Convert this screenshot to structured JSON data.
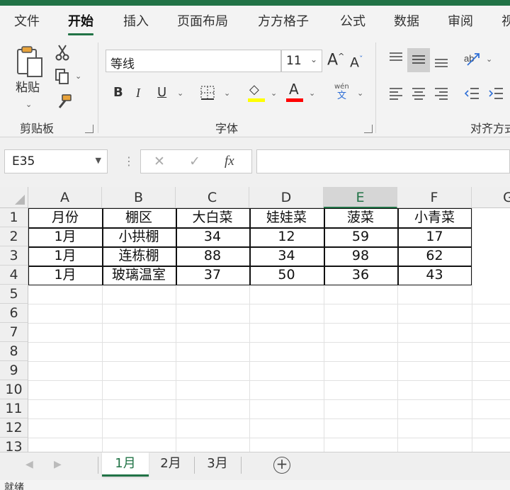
{
  "ribbon_tabs": [
    "文件",
    "开始",
    "插入",
    "页面布局",
    "方方格子",
    "公式",
    "数据",
    "审阅",
    "视"
  ],
  "active_tab": "开始",
  "clipboard": {
    "paste_label": "粘贴",
    "group_label": "剪贴板"
  },
  "font": {
    "name": "等线",
    "size": "11",
    "grow_label": "A",
    "shrink_label": "A",
    "bold_label": "B",
    "italic_label": "I",
    "underline_label": "U",
    "fill_label": "◇",
    "fontcolor_label": "A",
    "phonetic_top": "wén",
    "phonetic_bottom": "文",
    "group_label": "字体",
    "fill_color": "#ffff00",
    "font_color": "#ff0000"
  },
  "alignment": {
    "group_label": "对齐方式"
  },
  "formula_bar": {
    "name_box": "E35",
    "cancel": "✕",
    "enter": "✓",
    "fx": "fx",
    "value": ""
  },
  "grid": {
    "columns": [
      "A",
      "B",
      "C",
      "D",
      "E",
      "F",
      "G"
    ],
    "selected_column": "E",
    "rows": [
      "1",
      "2",
      "3",
      "4",
      "5",
      "6",
      "7",
      "8",
      "9",
      "10",
      "11",
      "12",
      "13"
    ],
    "table": [
      [
        "月份",
        "棚区",
        "大白菜",
        "娃娃菜",
        "菠菜",
        "小青菜"
      ],
      [
        "1月",
        "小拱棚",
        "34",
        "12",
        "59",
        "17"
      ],
      [
        "1月",
        "连栋棚",
        "88",
        "34",
        "98",
        "62"
      ],
      [
        "1月",
        "玻璃温室",
        "37",
        "50",
        "36",
        "43"
      ]
    ]
  },
  "sheets": {
    "tabs": [
      "1月",
      "2月",
      "3月"
    ],
    "active": "1月",
    "add": "+"
  },
  "status": {
    "text": "就绪"
  },
  "colors": {
    "accent": "#217346"
  }
}
